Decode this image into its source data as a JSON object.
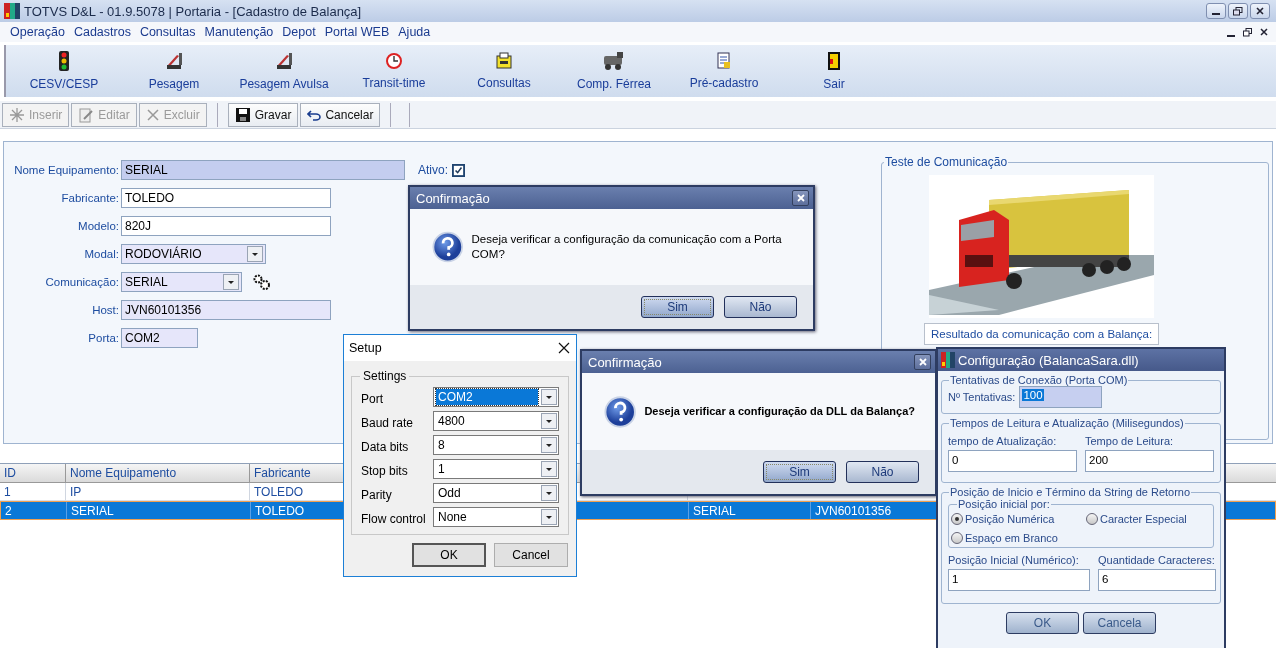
{
  "window": {
    "title": "TOTVS D&L - 01.9.5078 | Portaria - [Cadastro de Balança]"
  },
  "menu": [
    "Operação",
    "Cadastros",
    "Consultas",
    "Manutenção",
    "Depot",
    "Portal WEB",
    "Ajuda"
  ],
  "toolbar": [
    {
      "label": "CESV/CESP",
      "kind": "signal"
    },
    {
      "label": "Pesagem",
      "kind": "scale"
    },
    {
      "label": "Pesagem Avulsa",
      "kind": "scale"
    },
    {
      "label": "Transit-time",
      "kind": "clock"
    },
    {
      "label": "Consultas",
      "kind": "folder"
    },
    {
      "label": "Comp. Férrea",
      "kind": "train"
    },
    {
      "label": "Pré-cadastro",
      "kind": "form"
    },
    {
      "label": "Sair",
      "kind": "exit"
    }
  ],
  "actions": [
    {
      "label": "Inserir",
      "kind": "insert",
      "disabled": true
    },
    {
      "label": "Editar",
      "kind": "edit",
      "disabled": true
    },
    {
      "label": "Excluir",
      "kind": "delete",
      "disabled": true
    },
    {
      "label": "Gravar",
      "kind": "save",
      "disabled": false
    },
    {
      "label": "Cancelar",
      "kind": "undo",
      "disabled": false
    }
  ],
  "form": {
    "fields": [
      {
        "label": "Nome Equipamento:",
        "value": "SERIAL",
        "kind": "text",
        "focused": true,
        "highlighted": true
      },
      {
        "label": "Fabricante:",
        "value": "TOLEDO",
        "kind": "text",
        "focused": false,
        "highlighted": false
      },
      {
        "label": "Modelo:",
        "value": "820J",
        "kind": "text",
        "focused": false,
        "highlighted": false
      },
      {
        "label": "Modal:",
        "value": "RODOVIÁRIO",
        "kind": "combo",
        "focused": false,
        "highlighted": true
      },
      {
        "label": "Comunicação:",
        "value": "SERIAL",
        "kind": "combo-settings",
        "focused": false,
        "highlighted": true
      },
      {
        "label": "Host:",
        "value": "JVN60101356",
        "kind": "text",
        "focused": false,
        "highlighted": true
      },
      {
        "label": "Porta:",
        "value": "COM2",
        "kind": "text",
        "focused": false,
        "highlighted": true
      }
    ],
    "active": {
      "label": "Ativo:",
      "checked": true
    }
  },
  "test": {
    "title": "Teste de Comunicação",
    "result_label": "Resultado da comunicação com a Balança:"
  },
  "table": {
    "columns": [
      "ID",
      "Nome Equipamento",
      "Fabricante"
    ],
    "rows": [
      {
        "cells": [
          "1",
          "IP",
          "TOLEDO"
        ],
        "selected": false
      },
      {
        "cells": [
          "2",
          "SERIAL",
          "TOLEDO",
          "SERIAL",
          "JVN60101356"
        ],
        "selected": true
      }
    ]
  },
  "confirm_port": {
    "title": "Confirmação",
    "message": "Deseja verificar a configuração da comunicação com a Porta COM?",
    "buttons": [
      {
        "label": "Sim",
        "focused": true
      },
      {
        "label": "Não",
        "focused": false
      }
    ]
  },
  "setup": {
    "title": "Setup",
    "group": "Settings",
    "fields": [
      {
        "label": "Port",
        "value": "COM2",
        "selected": true
      },
      {
        "label": "Baud rate",
        "value": "4800",
        "selected": false
      },
      {
        "label": "Data bits",
        "value": "8",
        "selected": false
      },
      {
        "label": "Stop bits",
        "value": "1",
        "selected": false
      },
      {
        "label": "Parity",
        "value": "Odd",
        "selected": false
      },
      {
        "label": "Flow control",
        "value": "None",
        "selected": false
      }
    ],
    "buttons": [
      "OK",
      "Cancel"
    ]
  },
  "confirm_dll": {
    "title": "Confirmação",
    "message": "Deseja verificar a configuração da DLL da Balança?",
    "buttons": [
      {
        "label": "Sim",
        "focused": true
      },
      {
        "label": "Não",
        "focused": false
      }
    ]
  },
  "config": {
    "title": "Configuração (BalancaSara.dll)",
    "attempts": {
      "title": "Tentativas de Conexão (Porta COM)",
      "label": "Nº Tentativas:",
      "value": "100",
      "selected": true
    },
    "times": {
      "title": "Tempos de Leitura e Atualização (Milisegundos)",
      "fields": [
        {
          "label": "tempo de Atualização:",
          "value": "0"
        },
        {
          "label": "Tempo de Leitura:",
          "value": "200"
        }
      ]
    },
    "position": {
      "title": "Posição de Inicio e Término da String de Retorno",
      "mode_title": "Posição inicial por:",
      "options": [
        {
          "label": "Posição Numérica",
          "selected": true
        },
        {
          "label": "Caracter Especial",
          "selected": false
        },
        {
          "label": "Espaço em Branco",
          "selected": false
        }
      ],
      "fields": [
        {
          "label": "Posição Inicial (Numérico):",
          "value": "1"
        },
        {
          "label": "Quantidade Caracteres:",
          "value": "6"
        }
      ]
    },
    "buttons": [
      "OK",
      "Cancela"
    ]
  }
}
